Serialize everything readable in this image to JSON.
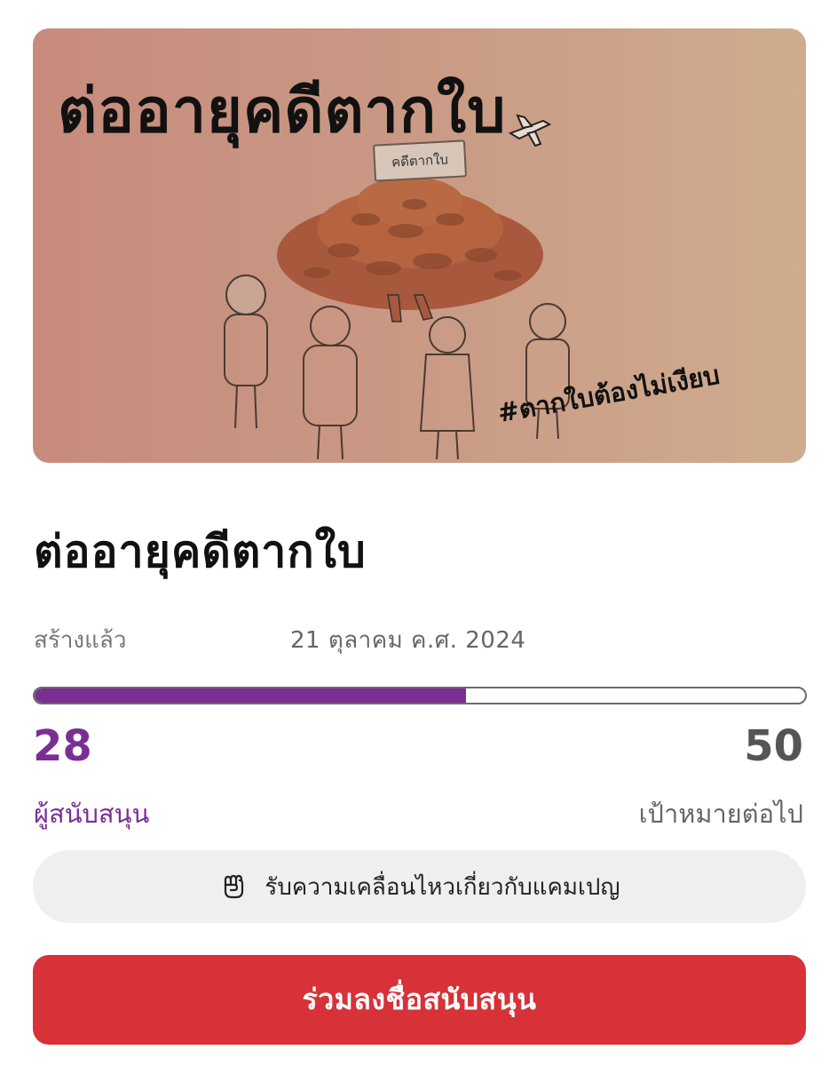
{
  "hero": {
    "title": "ต่ออายุคดีตากใบ",
    "sign_text": "คดีตากใบ",
    "hashtag": "#ตากใบต้องไม่เงียบ",
    "background_colors": [
      "#c78b7c",
      "#cfac8e"
    ]
  },
  "campaign": {
    "title": "ต่ออายุคดีตากใบ",
    "created_label": "สร้างแล้ว",
    "created_date": "21 ตุลาคม ค.ศ. 2024"
  },
  "progress": {
    "supporters": "28",
    "goal": "50",
    "fraction": 0.56,
    "supporters_label": "ผู้สนับสนุน",
    "goal_label": "เป้าหมายต่อไป",
    "accent_color": "#7b2f93"
  },
  "buttons": {
    "updates_label": "รับความเคลื่อนไหวเกี่ยวกับแคมเปญ",
    "updates_icon": "raised-fist-icon",
    "sign_label": "ร่วมลงชื่อสนับสนุน",
    "sign_color": "#d63238"
  }
}
